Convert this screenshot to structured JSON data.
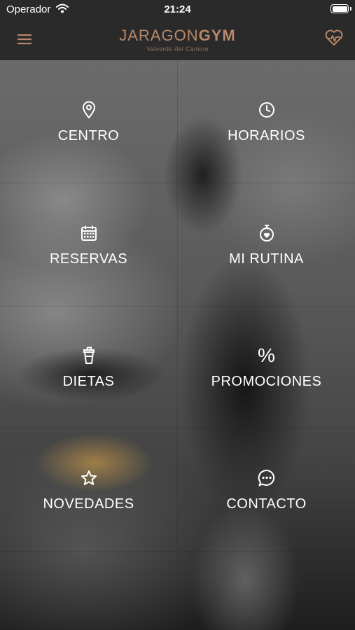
{
  "status_bar": {
    "carrier": "Operador",
    "time": "21:24"
  },
  "header": {
    "logo_prefix": "JARAGON",
    "logo_suffix": "GYM",
    "logo_subtitle": "Valverde del Camino",
    "brand_color": "#b7876a"
  },
  "menu": {
    "centro": "CENTRO",
    "horarios": "HORARIOS",
    "reservas": "RESERVAS",
    "mi_rutina": "MI RUTINA",
    "dietas": "DIETAS",
    "promociones": "PROMOCIONES",
    "promociones_icon_glyph": "%",
    "novedades": "NOVEDADES",
    "contacto": "CONTACTO"
  }
}
